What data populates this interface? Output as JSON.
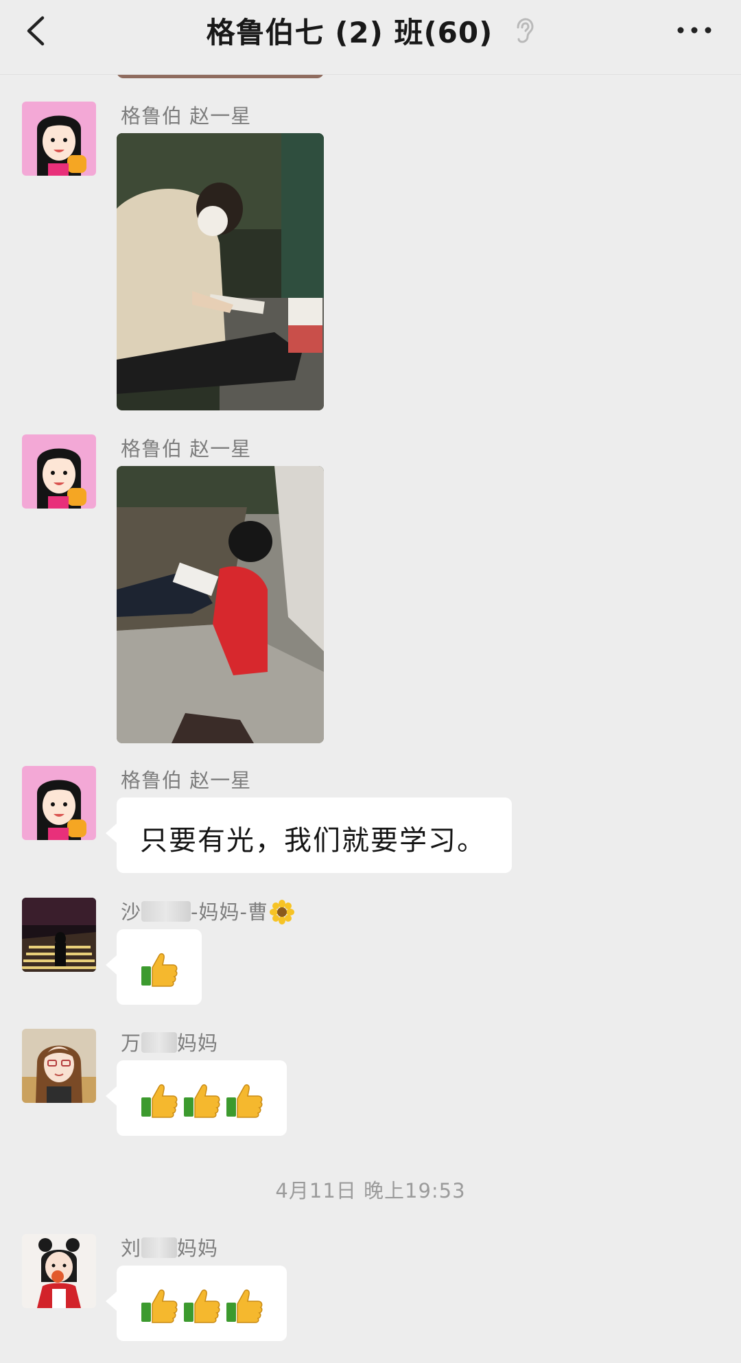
{
  "header": {
    "back_icon": "chevron-left-icon",
    "title": "格鲁伯七 (2) 班(60)",
    "ear_icon": "ear-icon",
    "more_icon": "more-dots-icon"
  },
  "messages": [
    {
      "sender": "格鲁伯 赵一星",
      "type": "image",
      "description_icon": "photo"
    },
    {
      "sender": "格鲁伯 赵一星",
      "type": "image",
      "description_icon": "photo"
    },
    {
      "sender": "格鲁伯 赵一星",
      "type": "text",
      "text": "只要有光，我们就要学习。"
    },
    {
      "sender_prefix": "沙",
      "sender_suffix": "-妈妈-曹",
      "type": "emoji",
      "emoji": "thumbs-up-icon",
      "count": 1
    },
    {
      "sender_prefix": "万",
      "sender_suffix": "妈妈",
      "type": "emoji",
      "emoji": "thumbs-up-icon",
      "count": 3
    },
    {
      "sender_prefix": "刘",
      "sender_suffix": "妈妈",
      "type": "emoji",
      "emoji": "thumbs-up-icon",
      "count": 3
    }
  ],
  "timestamp": "4月11日 晚上19:53",
  "colors": {
    "background": "#ededed",
    "bubble": "#ffffff",
    "sender_text": "#7d7d7d",
    "timestamp_text": "#9b9b9b"
  }
}
